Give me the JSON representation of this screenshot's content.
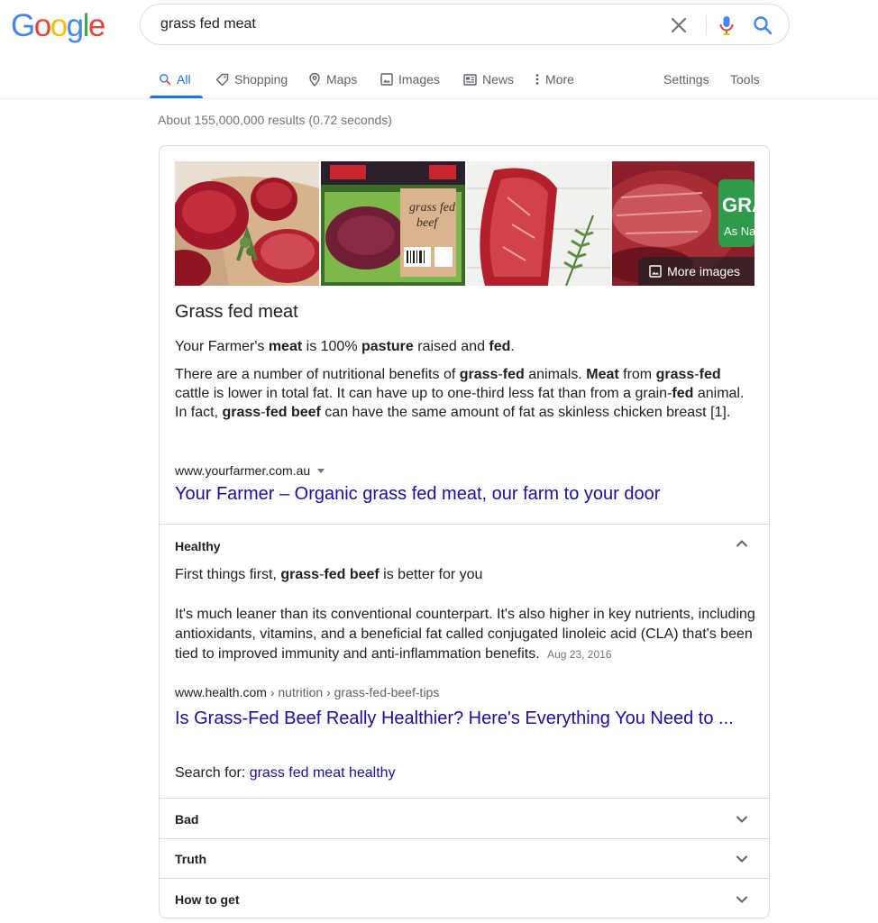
{
  "logo": {
    "letters": [
      "G",
      "o",
      "o",
      "g",
      "l",
      "e"
    ],
    "colors": [
      "#4285F4",
      "#EA4335",
      "#FBBC05",
      "#4285F4",
      "#34A853",
      "#EA4335"
    ]
  },
  "search": {
    "query": "grass fed meat"
  },
  "tabs": {
    "all": "All",
    "shopping": "Shopping",
    "maps": "Maps",
    "images": "Images",
    "news": "News",
    "more": "More",
    "settings": "Settings",
    "tools": "Tools"
  },
  "result_stats": "About 155,000,000 results (0.72 seconds)",
  "featured": {
    "more_images": "More images",
    "thumb4_overlay_text": "GRA",
    "thumb4_overlay_sub": "As Na",
    "title": "Grass fed meat",
    "line1": [
      "Your Farmer's ",
      "meat",
      " is 100% ",
      "pasture",
      " raised and ",
      "fed",
      "."
    ],
    "para": [
      "There are a number of nutritional benefits of ",
      "grass",
      "-",
      "fed",
      " animals. ",
      "Meat",
      " from ",
      "grass",
      "-",
      "fed",
      " cattle is lower in total fat. It can have up to one-third less fat than from a grain-",
      "fed",
      " animal. In fact, ",
      "grass",
      "-",
      "fed beef",
      " can have the same amount of fat as skinless chicken breast [1]."
    ],
    "cite": "www.yourfarmer.com.au",
    "link": "Your Farmer – Organic grass fed meat, our farm to your door"
  },
  "accordion": {
    "healthy": {
      "header": "Healthy",
      "line1": [
        "First things first, ",
        "grass",
        "-",
        "fed beef",
        " is better for you"
      ],
      "para": "It's much leaner than its conventional counterpart. It's also higher in key nutrients, including antioxidants, vitamins, and a beneficial fat called conjugated linoleic acid (CLA) that's been tied to improved immunity and anti-inflammation benefits.",
      "date": "Aug 23, 2016",
      "cite_domain": "www.health.com",
      "cite_path": " › nutrition › grass-fed-beef-tips",
      "link": "Is Grass-Fed Beef Really Healthier? Here's Everything You Need to ...",
      "search_for_label": "Search for: ",
      "search_for_link": "grass fed meat healthy"
    },
    "bad": {
      "header": "Bad"
    },
    "truth": {
      "header": "Truth"
    },
    "how_to_get": {
      "header": "How to get"
    }
  },
  "colors": {
    "link": "#1a0dab",
    "accent": "#1a73e8",
    "muted": "#70757a"
  }
}
